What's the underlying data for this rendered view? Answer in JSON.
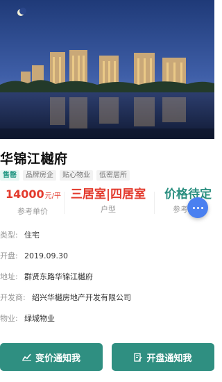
{
  "project": {
    "name": "华锦江樾府",
    "tags": [
      "售罄",
      "品牌房企",
      "贴心物业",
      "低密居所"
    ]
  },
  "stats": {
    "price_value": "14000",
    "price_unit": "元/平",
    "price_label": "参考单价",
    "layout_value": "三居室|四居室",
    "layout_label": "户型",
    "total_value": "价格待定",
    "total_label": "参考总价"
  },
  "info": [
    {
      "key": "类型:",
      "value": "住宅"
    },
    {
      "key": "开盘:",
      "value": "2019.09.30"
    },
    {
      "key": "地址:",
      "value": "群贤东路华锦江樾府"
    },
    {
      "key": "开发商:",
      "value": "绍兴华樾房地产开发有限公司"
    },
    {
      "key": "物业:",
      "value": "绿城物业"
    }
  ],
  "buttons": {
    "price_notify": "变价通知我",
    "opening_notify": "开盘通知我"
  },
  "icons": {
    "price_notify": "trend-line-icon",
    "opening_notify": "document-edit-icon",
    "fab": "more-dots-icon"
  },
  "colors": {
    "accent": "#2f8f81",
    "price_red": "#e33a2d",
    "fab_blue": "#4a80f0"
  }
}
